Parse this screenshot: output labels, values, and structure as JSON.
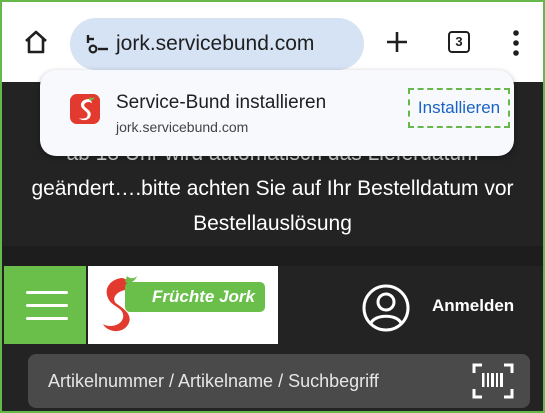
{
  "browser": {
    "url": "jork.servicebund.com",
    "tab_count": "3",
    "icons": [
      "home-icon",
      "site-settings-icon",
      "new-tab-icon",
      "tab-switcher-icon",
      "more-menu-icon"
    ]
  },
  "install_prompt": {
    "title": "Service-Bund installieren",
    "url": "jork.servicebund.com",
    "button_label": "Installieren"
  },
  "page": {
    "notice_lines": [
      "ab 18 Uhr wird automatisch das Lieferdatum",
      "geändert….bitte achten Sie auf Ihr Bestelldatum vor",
      "Bestellauslösung"
    ],
    "logo_text": "Früchte Jork",
    "login_label": "Anmelden",
    "search_placeholder": "Artikelnummer / Artikelname / Suchbegriff"
  },
  "colors": {
    "accent_green": "#6abf4b",
    "link_blue": "#1a63c4",
    "url_pill": "#d6e3f5",
    "page_dark": "#232323"
  }
}
